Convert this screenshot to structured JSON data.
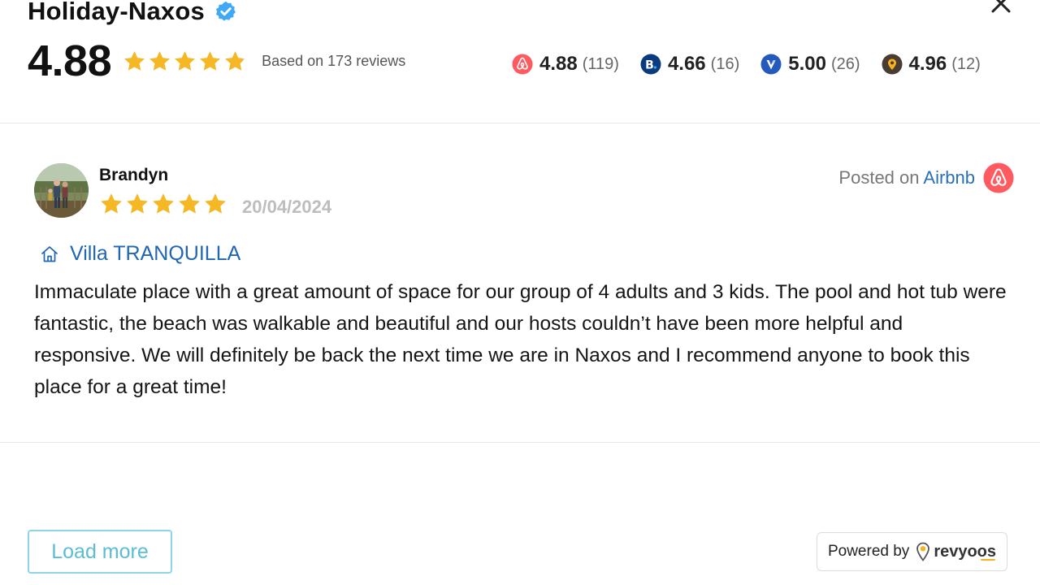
{
  "header": {
    "title": "Holiday-Naxos"
  },
  "summary": {
    "rating": "4.88",
    "stars": 4.88,
    "based_on": "Based on 173 reviews"
  },
  "platforms": [
    {
      "icon": "airbnb-icon",
      "rating": "4.88",
      "count": "(119)",
      "color": "#ff5a5f"
    },
    {
      "icon": "booking-icon",
      "rating": "4.66",
      "count": "(16)",
      "color": "#003580"
    },
    {
      "icon": "vrbo-icon",
      "rating": "5.00",
      "count": "(26)",
      "color": "#245abc"
    },
    {
      "icon": "revyoos-icon",
      "rating": "4.96",
      "count": "(12)",
      "color": "#4a3b33"
    }
  ],
  "review": {
    "reviewer": "Brandyn",
    "stars": 5,
    "date": "20/04/2024",
    "posted_prefix": "Posted on ",
    "posted_source": "Airbnb",
    "property": "Villa TRANQUILLA",
    "text": "Immaculate place with a great amount of space for our group of 4 adults and 3 kids. The pool and hot tub were fantastic, the beach was walkable and beautiful and our hosts couldn’t have been more helpful and responsive. We will definitely be back the next time we are in Naxos and I recommend anyone to book this place for a great time!"
  },
  "footer": {
    "load_more": "Load more",
    "powered_by": "Powered by",
    "brand": "revyoos"
  },
  "colors": {
    "star": "#f5b724",
    "star_empty": "#d8d8d8",
    "link": "#1f66b3",
    "verified": "#3fa9f5"
  }
}
